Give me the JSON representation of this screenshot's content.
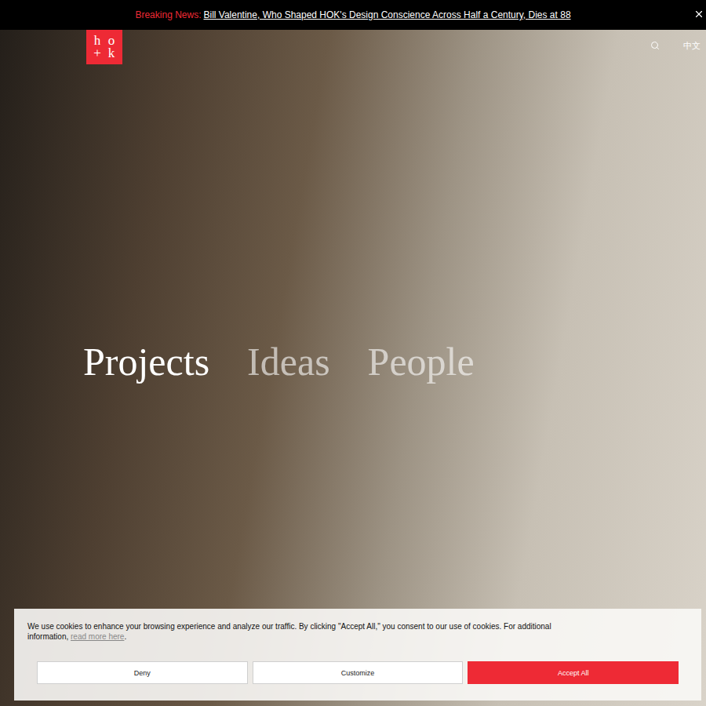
{
  "announcement": {
    "label": "Breaking News:",
    "link": "Bill Valentine, Who Shaped HOK's Design Conscience Across Half a Century, Dies at 88"
  },
  "logo": {
    "letters": [
      "h",
      "o",
      "+",
      "k"
    ]
  },
  "header": {
    "language": "中文"
  },
  "hero": {
    "nav": [
      {
        "label": "Projects",
        "selected": true
      },
      {
        "label": "Ideas",
        "selected": false
      },
      {
        "label": "People",
        "selected": false
      }
    ]
  },
  "cookie_banner": {
    "text": "We use cookies to enhance your browsing experience and analyze our traffic. By clicking \"Accept All,\" you consent to our use of cookies. For additional information,",
    "link": "read more here",
    "link_suffix": ".",
    "buttons": [
      {
        "label": "Deny",
        "kind": "secondary"
      },
      {
        "label": "Customize",
        "kind": "secondary"
      },
      {
        "label": "Accept All",
        "kind": "primary"
      }
    ]
  }
}
